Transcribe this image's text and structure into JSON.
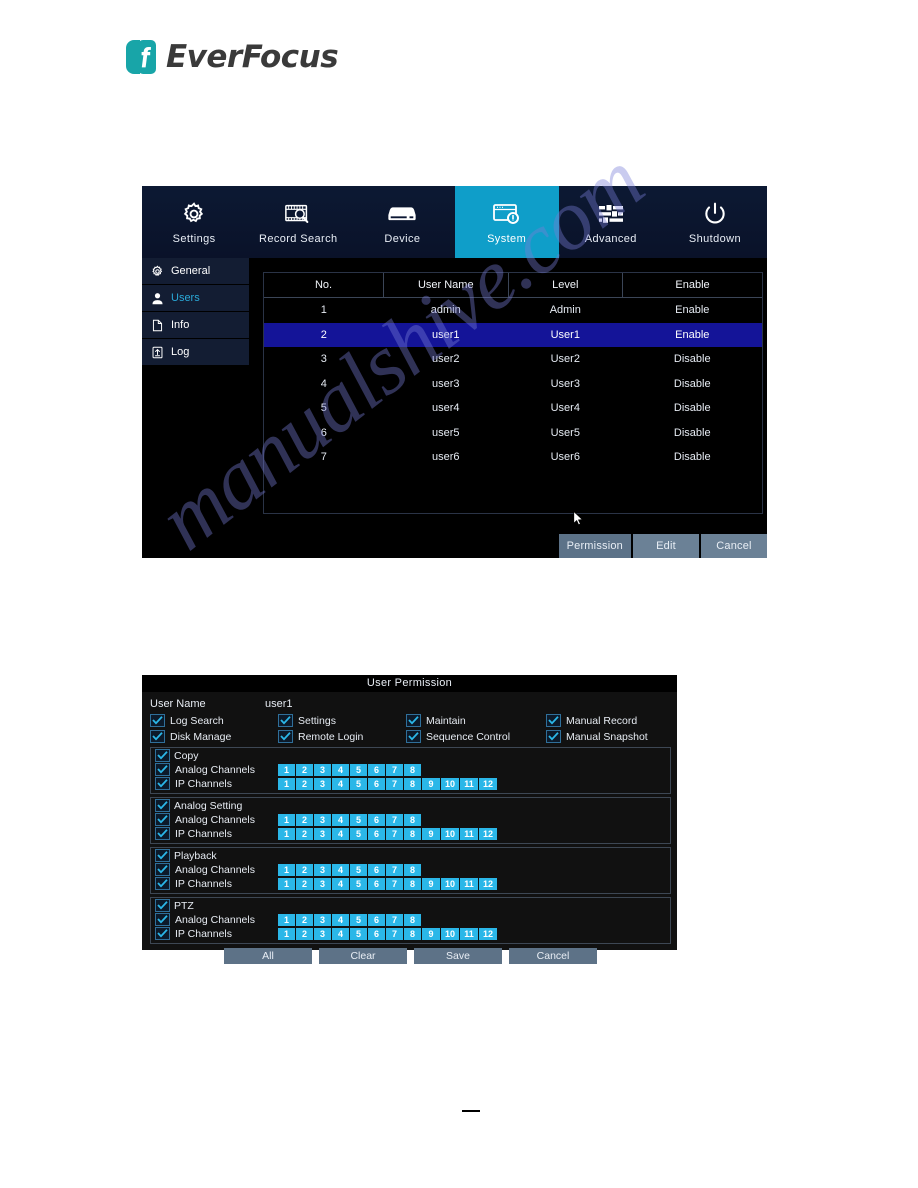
{
  "brand": {
    "name": "EverFocus",
    "logo_color": "#18a5a8",
    "text_color": "#3a3a3a"
  },
  "watermark": {
    "text": "manualshive.com",
    "color": "#787dd7"
  },
  "dvr_users_panel": {
    "nav": {
      "active_color": "#0f9ec9",
      "items": [
        {
          "label": "Settings",
          "icon": "gear-icon",
          "active": false
        },
        {
          "label": "Record Search",
          "icon": "record-search-icon",
          "active": false
        },
        {
          "label": "Device",
          "icon": "device-icon",
          "active": false
        },
        {
          "label": "System",
          "icon": "system-icon",
          "active": true
        },
        {
          "label": "Advanced",
          "icon": "sliders-icon",
          "active": false
        },
        {
          "label": "Shutdown",
          "icon": "power-icon",
          "active": false
        }
      ]
    },
    "sidebar": {
      "items": [
        {
          "label": "General",
          "icon": "gear-icon",
          "active": false
        },
        {
          "label": "Users",
          "icon": "user-icon",
          "active": true
        },
        {
          "label": "Info",
          "icon": "document-icon",
          "active": false
        },
        {
          "label": "Log",
          "icon": "log-icon",
          "active": false
        }
      ]
    },
    "table": {
      "headers": [
        "No.",
        "User Name",
        "Level",
        "Enable"
      ],
      "rows": [
        {
          "no": "1",
          "user_name": "admin",
          "level": "Admin",
          "enable": "Enable",
          "selected": false
        },
        {
          "no": "2",
          "user_name": "user1",
          "level": "User1",
          "enable": "Enable",
          "selected": true
        },
        {
          "no": "3",
          "user_name": "user2",
          "level": "User2",
          "enable": "Disable",
          "selected": false
        },
        {
          "no": "4",
          "user_name": "user3",
          "level": "User3",
          "enable": "Disable",
          "selected": false
        },
        {
          "no": "5",
          "user_name": "user4",
          "level": "User4",
          "enable": "Disable",
          "selected": false
        },
        {
          "no": "6",
          "user_name": "user5",
          "level": "User5",
          "enable": "Disable",
          "selected": false
        },
        {
          "no": "7",
          "user_name": "user6",
          "level": "User6",
          "enable": "Disable",
          "selected": false
        }
      ],
      "selected_row_color": "#141498"
    },
    "buttons": {
      "permission": "Permission",
      "edit": "Edit",
      "cancel": "Cancel"
    }
  },
  "user_permission_dialog": {
    "title": "User Permission",
    "user_name_label": "User Name",
    "user_name_value": "user1",
    "permissions": [
      {
        "label": "Log Search",
        "checked": true
      },
      {
        "label": "Settings",
        "checked": true
      },
      {
        "label": "Maintain",
        "checked": true
      },
      {
        "label": "Manual Record",
        "checked": true
      },
      {
        "label": "Disk Manage",
        "checked": true
      },
      {
        "label": "Remote Login",
        "checked": true
      },
      {
        "label": "Sequence Control",
        "checked": true
      },
      {
        "label": "Manual Snapshot",
        "checked": true
      }
    ],
    "channel_label_analog": "Analog Channels",
    "channel_label_ip": "IP Channels",
    "analog_channels": [
      "1",
      "2",
      "3",
      "4",
      "5",
      "6",
      "7",
      "8"
    ],
    "ip_channels": [
      "1",
      "2",
      "3",
      "4",
      "5",
      "6",
      "7",
      "8",
      "9",
      "10",
      "11",
      "12"
    ],
    "chip_color": "#2bb7e8",
    "groups": [
      {
        "label": "Copy",
        "checked": true
      },
      {
        "label": "Analog Setting",
        "checked": true
      },
      {
        "label": "Playback",
        "checked": true
      },
      {
        "label": "PTZ",
        "checked": true
      }
    ],
    "buttons": {
      "all": "All",
      "clear": "Clear",
      "save": "Save",
      "cancel": "Cancel"
    }
  }
}
